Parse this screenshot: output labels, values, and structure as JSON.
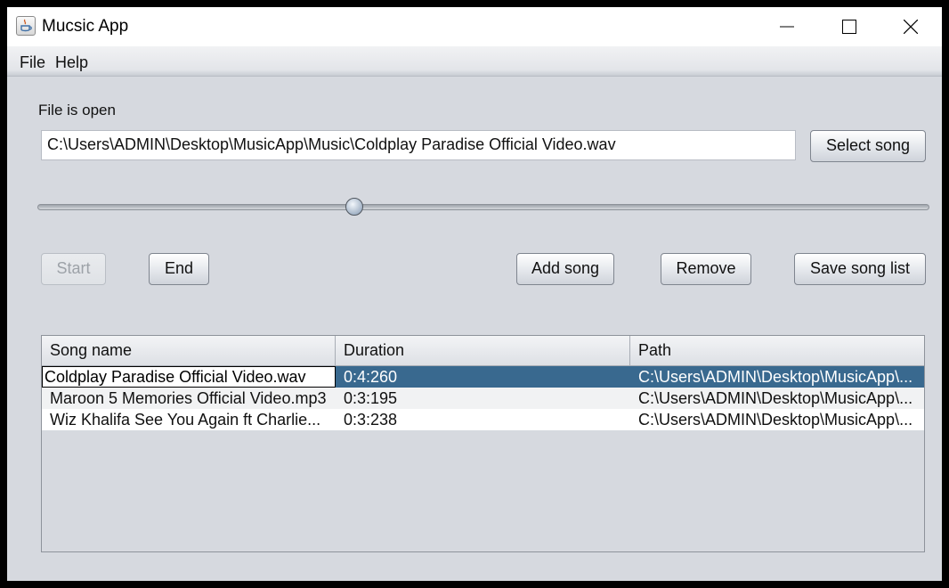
{
  "window": {
    "title": "Mucsic App",
    "icon": "java-cup-icon"
  },
  "menu": [
    "File",
    "Help"
  ],
  "status": "File is open",
  "path_field": {
    "value": "C:\\Users\\ADMIN\\Desktop\\MusicApp\\Music\\Coldplay  Paradise Official Video.wav"
  },
  "buttons": {
    "select_song": "Select song",
    "start": "Start",
    "end": "End",
    "add_song": "Add song",
    "remove": "Remove",
    "save_song_list": "Save song list"
  },
  "slider": {
    "position_fraction": 0.355
  },
  "table": {
    "columns": [
      "Song name",
      "Duration",
      "Path"
    ],
    "rows": [
      {
        "name": "Coldplay  Paradise Official Video.wav",
        "duration": "0:4:260",
        "path": "C:\\Users\\ADMIN\\Desktop\\MusicApp\\..."
      },
      {
        "name": "Maroon 5  Memories Official Video.mp3",
        "duration": "0:3:195",
        "path": "C:\\Users\\ADMIN\\Desktop\\MusicApp\\..."
      },
      {
        "name": "Wiz Khalifa  See You Again ft Charlie...",
        "duration": "0:3:238",
        "path": "C:\\Users\\ADMIN\\Desktop\\MusicApp\\..."
      }
    ]
  }
}
